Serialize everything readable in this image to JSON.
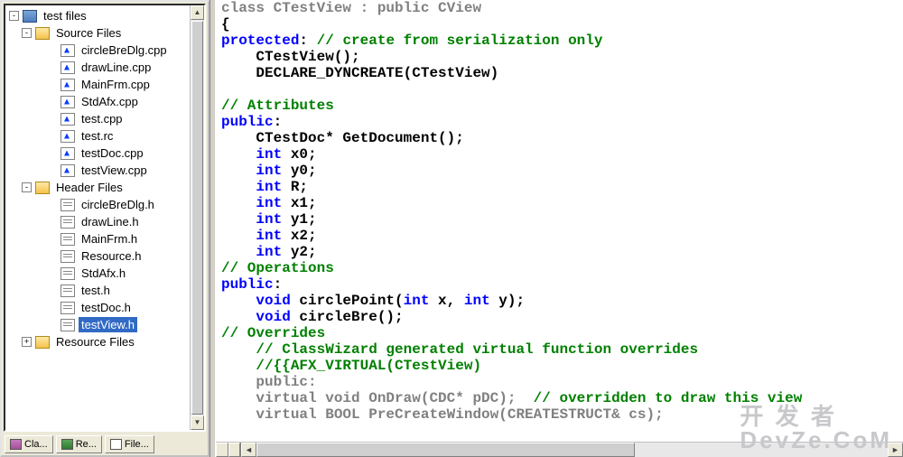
{
  "tree": {
    "root": {
      "label": "test files",
      "expander": "-"
    },
    "folders": [
      {
        "label": "Source Files",
        "expander": "-",
        "children": [
          {
            "label": "circleBreDlg.cpp",
            "kind": "cpp"
          },
          {
            "label": "drawLine.cpp",
            "kind": "cpp"
          },
          {
            "label": "MainFrm.cpp",
            "kind": "cpp"
          },
          {
            "label": "StdAfx.cpp",
            "kind": "cpp"
          },
          {
            "label": "test.cpp",
            "kind": "cpp"
          },
          {
            "label": "test.rc",
            "kind": "cpp"
          },
          {
            "label": "testDoc.cpp",
            "kind": "cpp"
          },
          {
            "label": "testView.cpp",
            "kind": "cpp"
          }
        ]
      },
      {
        "label": "Header Files",
        "expander": "-",
        "children": [
          {
            "label": "circleBreDlg.h",
            "kind": "h"
          },
          {
            "label": "drawLine.h",
            "kind": "h"
          },
          {
            "label": "MainFrm.h",
            "kind": "h"
          },
          {
            "label": "Resource.h",
            "kind": "h"
          },
          {
            "label": "StdAfx.h",
            "kind": "h"
          },
          {
            "label": "test.h",
            "kind": "h"
          },
          {
            "label": "testDoc.h",
            "kind": "h"
          },
          {
            "label": "testView.h",
            "kind": "h",
            "selected": true
          }
        ]
      },
      {
        "label": "Resource Files",
        "expander": "+",
        "children": []
      }
    ]
  },
  "tabs": [
    {
      "label": "Cla...",
      "icon": "cla"
    },
    {
      "label": "Re...",
      "icon": "re"
    },
    {
      "label": "File...",
      "icon": "file"
    }
  ],
  "scroll_icons": {
    "up": "▲",
    "down": "▼",
    "left": "◄",
    "right": "►"
  },
  "watermark": {
    "line1": "开 发 者",
    "line2": "DevZe.CoM"
  },
  "code": {
    "lines": [
      [
        [
          "gray",
          "class CTestView : public CView"
        ]
      ],
      [
        [
          "blk",
          "{"
        ]
      ],
      [
        [
          "kw",
          "protected"
        ],
        [
          "blk",
          ":"
        ],
        [
          "cm",
          " // create from serialization only"
        ]
      ],
      [
        [
          "blk",
          "    CTestView();"
        ]
      ],
      [
        [
          "blk",
          "    DECLARE_DYNCREATE(CTestView)"
        ]
      ],
      [],
      [
        [
          "cm",
          "// Attributes"
        ]
      ],
      [
        [
          "kw",
          "public"
        ],
        [
          "blk",
          ":"
        ]
      ],
      [
        [
          "blk",
          "    CTestDoc* GetDocument();"
        ]
      ],
      [
        [
          "blk",
          "    "
        ],
        [
          "kw",
          "int"
        ],
        [
          "blk",
          " x0;"
        ]
      ],
      [
        [
          "blk",
          "    "
        ],
        [
          "kw",
          "int"
        ],
        [
          "blk",
          " y0;"
        ]
      ],
      [
        [
          "blk",
          "    "
        ],
        [
          "kw",
          "int"
        ],
        [
          "blk",
          " R;"
        ]
      ],
      [
        [
          "blk",
          "    "
        ],
        [
          "kw",
          "int"
        ],
        [
          "blk",
          " x1;"
        ]
      ],
      [
        [
          "blk",
          "    "
        ],
        [
          "kw",
          "int"
        ],
        [
          "blk",
          " y1;"
        ]
      ],
      [
        [
          "blk",
          "    "
        ],
        [
          "kw",
          "int"
        ],
        [
          "blk",
          " x2;"
        ]
      ],
      [
        [
          "blk",
          "    "
        ],
        [
          "kw",
          "int"
        ],
        [
          "blk",
          " y2;"
        ]
      ],
      [
        [
          "cm",
          "// Operations"
        ]
      ],
      [
        [
          "kw",
          "public"
        ],
        [
          "blk",
          ":"
        ]
      ],
      [
        [
          "blk",
          "    "
        ],
        [
          "kw",
          "void"
        ],
        [
          "blk",
          " circlePoint("
        ],
        [
          "kw",
          "int"
        ],
        [
          "blk",
          " x, "
        ],
        [
          "kw",
          "int"
        ],
        [
          "blk",
          " y);"
        ]
      ],
      [
        [
          "blk",
          "    "
        ],
        [
          "kw",
          "void"
        ],
        [
          "blk",
          " circleBre();"
        ]
      ],
      [
        [
          "cm",
          "// Overrides"
        ]
      ],
      [
        [
          "blk",
          "    "
        ],
        [
          "cm",
          "// ClassWizard generated virtual function overrides"
        ]
      ],
      [
        [
          "blk",
          "    "
        ],
        [
          "cm",
          "//{{AFX_VIRTUAL(CTestView)"
        ]
      ],
      [
        [
          "blk",
          "    "
        ],
        [
          "gray",
          "public:"
        ]
      ],
      [
        [
          "blk",
          "    "
        ],
        [
          "gray",
          "virtual void OnDraw(CDC* pDC);  "
        ],
        [
          "cm",
          "// overridden to draw this view"
        ]
      ],
      [
        [
          "blk",
          "    "
        ],
        [
          "gray",
          "virtual BOOL PreCreateWindow(CREATESTRUCT& cs);"
        ]
      ]
    ]
  }
}
